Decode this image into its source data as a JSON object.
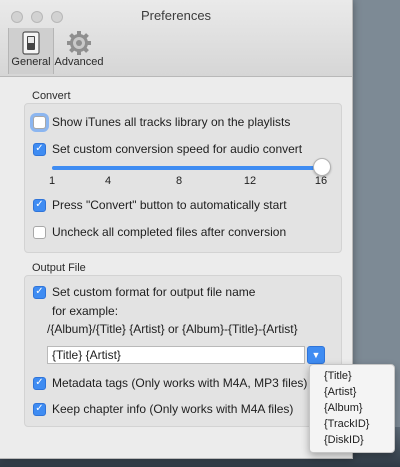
{
  "window": {
    "title": "Preferences",
    "toolbar": [
      {
        "label": "General",
        "icon": "switch-icon",
        "selected": true
      },
      {
        "label": "Advanced",
        "icon": "gear-icon",
        "selected": false
      }
    ]
  },
  "convert": {
    "section_label": "Convert",
    "show_itunes": {
      "label": "Show iTunes all tracks library on the playlists",
      "checked": false
    },
    "custom_speed": {
      "label": "Set custom conversion speed for audio convert",
      "checked": true
    },
    "speed_slider": {
      "ticks": [
        "1",
        "4",
        "8",
        "12",
        "16"
      ],
      "value": 16,
      "min": 1,
      "max": 16
    },
    "press_convert": {
      "label": "Press \"Convert\" button to automatically start",
      "checked": true
    },
    "uncheck_completed": {
      "label": "Uncheck all completed files after conversion",
      "checked": false
    }
  },
  "output": {
    "section_label": "Output File",
    "custom_format": {
      "label": "Set custom format for output file name",
      "checked": true
    },
    "example_label": "for example:",
    "example_value": "/{Album}/{Title} {Artist} or {Album}-{Title}-{Artist}",
    "format_value": "{Title} {Artist}",
    "metadata_tags": {
      "label": "Metadata tags (Only works with M4A, MP3 files)",
      "checked": true
    },
    "keep_chapter": {
      "label": "Keep chapter info (Only works with M4A files)",
      "checked": true
    }
  },
  "format_menu": [
    "{Title}",
    "{Artist}",
    "{Album}",
    "{TrackID}",
    "{DiskID}"
  ],
  "colors": {
    "accent": "#3f8cf2",
    "window_bg": "#ececec"
  }
}
